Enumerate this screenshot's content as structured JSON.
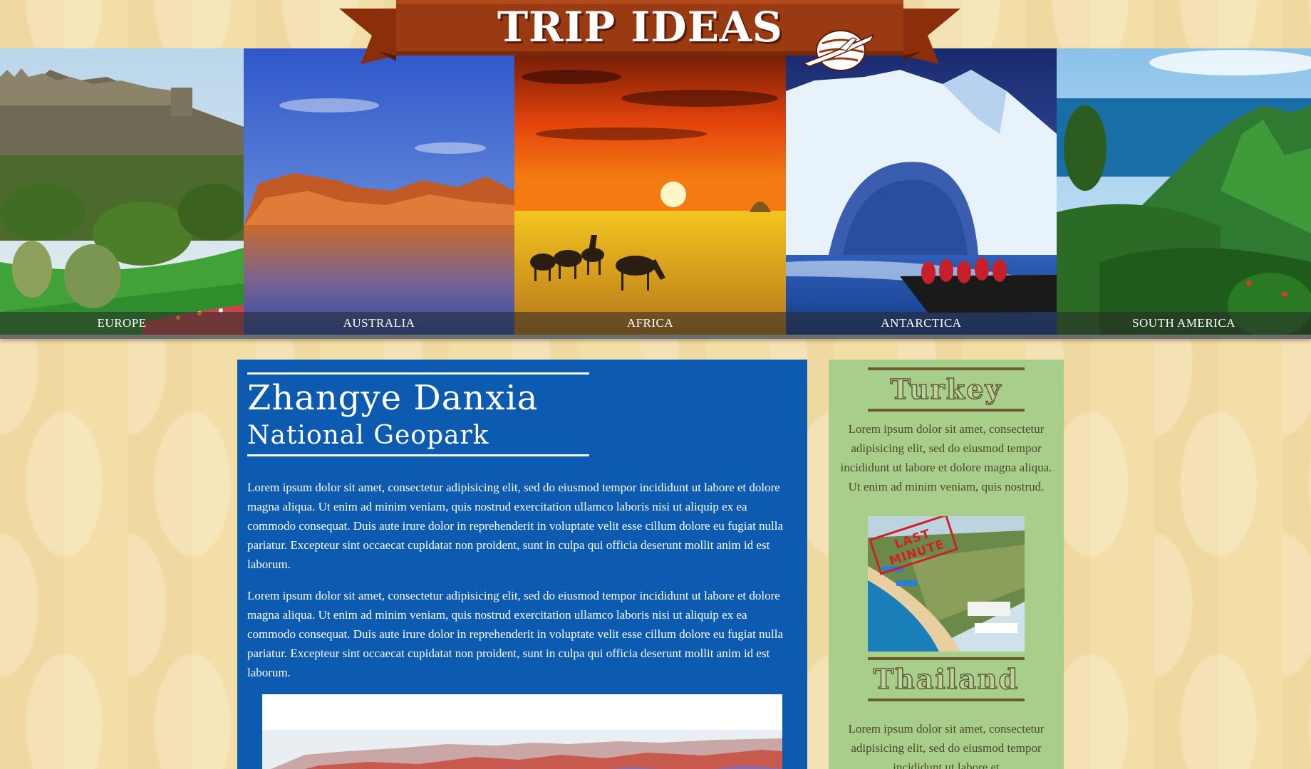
{
  "header": {
    "title": "TRIP IDEAS",
    "logo_icon": "globe-airplane-icon",
    "banner_color": "#9a3a12"
  },
  "regions": [
    {
      "label": "EUROPE",
      "icon": "castle-landscape"
    },
    {
      "label": "AUSTRALIA",
      "icon": "red-rock-lake"
    },
    {
      "label": "AFRICA",
      "icon": "savanna-sunset-zebras"
    },
    {
      "label": "ANTARCTICA",
      "icon": "iceberg-boat"
    },
    {
      "label": "SOUTH AMERICA",
      "icon": "tropical-mountains"
    }
  ],
  "article": {
    "title": "Zhangye Danxia",
    "subtitle": "National Geopark",
    "paragraphs": [
      "Lorem ipsum dolor sit amet, consectetur adipisicing elit, sed do eiusmod tempor incididunt ut labore et dolore magna aliqua. Ut enim ad minim veniam, quis nostrud exercitation ullamco laboris nisi ut aliquip ex ea commodo consequat. Duis aute irure dolor in reprehenderit in voluptate velit esse cillum dolore eu fugiat nulla pariatur. Excepteur sint occaecat cupidatat non proident, sunt in culpa qui officia deserunt mollit anim id est laborum.",
      "Lorem ipsum dolor sit amet, consectetur adipisicing elit, sed do eiusmod tempor incididunt ut labore et dolore magna aliqua. Ut enim ad minim veniam, quis nostrud exercitation ullamco laboris nisi ut aliquip ex ea commodo consequat. Duis aute irure dolor in reprehenderit in voluptate velit esse cillum dolore eu fugiat nulla pariatur. Excepteur sint occaecat cupidatat non proident, sunt in culpa qui officia deserunt mollit anim id est laborum."
    ],
    "background_color": "#0c5bb1"
  },
  "sidebar": {
    "background_color": "#a7cf8b",
    "items": [
      {
        "heading": "Turkey",
        "text": "Lorem ipsum dolor sit amet, consectetur adipisicing elit, sed do eiusmod tempor incididunt ut labore et dolore magna aliqua. Ut enim ad minim veniam, quis nostrud.",
        "stamp": "LAST MINUTE"
      },
      {
        "heading": "Thailand",
        "text": "Lorem ipsum dolor sit amet, consectetur adipisicing elit, sed do eiusmod tempor incididunt ut labore et"
      }
    ]
  }
}
